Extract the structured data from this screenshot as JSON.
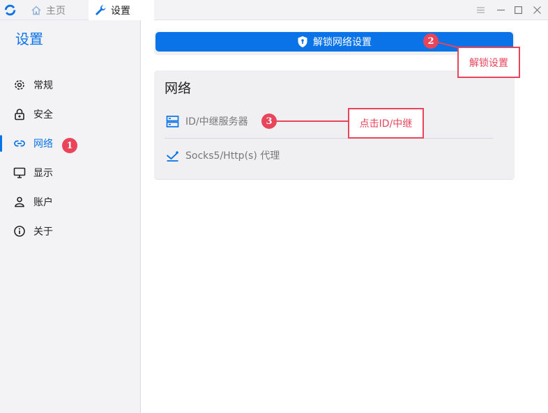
{
  "titlebar": {
    "tabs": [
      {
        "label": "主页",
        "icon": "home-icon"
      },
      {
        "label": "设置",
        "icon": "wrench-icon"
      }
    ],
    "controls": [
      "menu-icon",
      "minimize-icon",
      "maximize-icon",
      "close-icon"
    ]
  },
  "sidebar": {
    "title": "设置",
    "items": [
      {
        "label": "常规",
        "icon": "gear-icon"
      },
      {
        "label": "安全",
        "icon": "lock-icon"
      },
      {
        "label": "网络",
        "icon": "link-icon",
        "active": true
      },
      {
        "label": "显示",
        "icon": "monitor-icon"
      },
      {
        "label": "账户",
        "icon": "user-icon"
      },
      {
        "label": "关于",
        "icon": "info-icon"
      }
    ]
  },
  "main": {
    "unlock_button": {
      "label": "解锁网络设置",
      "icon": "shield-icon"
    },
    "network": {
      "title": "网络",
      "rows": [
        {
          "label": "ID/中继服务器",
          "icon": "server-icon"
        },
        {
          "label": "Socks5/Http(s) 代理",
          "icon": "proxy-icon"
        }
      ]
    }
  },
  "annotations": {
    "badges": [
      "1",
      "2",
      "3"
    ],
    "callouts": {
      "unlock": "解锁设置",
      "relay": "点击ID/中继"
    }
  },
  "colors": {
    "accent": "#0b73e8",
    "annotation": "#e8445a",
    "sidebar_bg": "#f3f3f5",
    "card_bg": "#f0f0f2"
  }
}
